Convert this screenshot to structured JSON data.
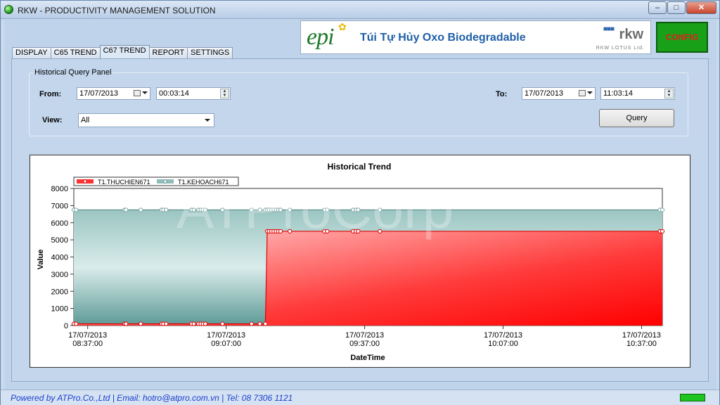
{
  "window": {
    "title": "RKW - PRODUCTIVITY MANAGEMENT SOLUTION"
  },
  "banner": {
    "logo": "epi",
    "text": "Túi Tự Hủy Oxo Biodegradable",
    "brand": "rkw",
    "brand_sub": "RKW LOTUS Ltd."
  },
  "config_button": "CONFIG",
  "tabs": [
    {
      "label": "DISPLAY"
    },
    {
      "label": "C65 TREND"
    },
    {
      "label": "C67 TREND"
    },
    {
      "label": "REPORT"
    },
    {
      "label": "SETTINGS"
    }
  ],
  "active_tab": "C67 TREND",
  "query_panel": {
    "title": "Historical Query Panel",
    "from_label": "From:",
    "from_date": "17/07/2013",
    "from_time": "00:03:14",
    "to_label": "To:",
    "to_date": "17/07/2013",
    "to_time": "11:03:14",
    "view_label": "View:",
    "view_value": "All",
    "query_button": "Query"
  },
  "watermark": "ATProCorp",
  "status": {
    "text": "Powered by ATPro.Co.,Ltd | Email: hotro@atpro.com.vn | Tel: 08 7306 1121"
  },
  "chart_data": {
    "type": "area",
    "title": "Historical Trend",
    "xlabel": "DateTime",
    "ylabel": "Value",
    "ylim": [
      0,
      8000
    ],
    "yticks": [
      0,
      1000,
      2000,
      3000,
      4000,
      5000,
      6000,
      7000,
      8000
    ],
    "xticks": [
      "17/07/2013\n08:37:00",
      "17/07/2013\n09:07:00",
      "17/07/2013\n09:37:00",
      "17/07/2013\n10:07:00",
      "17/07/2013\n10:37:00"
    ],
    "xtick_minutes": [
      0,
      30,
      60,
      90,
      120
    ],
    "xlim_minutes": [
      -3,
      124.5
    ],
    "legend": "top-left",
    "grid": false,
    "series": [
      {
        "name": "T1.THUCHIEN671",
        "color": "#ff0000",
        "points_minutes": [
          -3,
          -2.5,
          8,
          8.3,
          11.5,
          16,
          16.4,
          17,
          22.5,
          23,
          24,
          24.5,
          25,
          25.5,
          29.2,
          35.5,
          37.3,
          38.5,
          38.9,
          39.3,
          39.8,
          40.3,
          40.8,
          41.3,
          41.8,
          43.8,
          51.3,
          51.9,
          57.5,
          58.1,
          58.6,
          63.3,
          124,
          124.5
        ],
        "values": [
          100,
          100,
          100,
          100,
          100,
          100,
          100,
          100,
          100,
          100,
          100,
          100,
          100,
          100,
          100,
          100,
          100,
          100,
          5500,
          5500,
          5500,
          5500,
          5500,
          5500,
          5500,
          5500,
          5500,
          5500,
          5500,
          5500,
          5500,
          5500,
          5500,
          5500
        ]
      },
      {
        "name": "T1.KEHOACH671",
        "color": "#7fb3b0",
        "points_minutes": [
          -3,
          -2.5,
          8,
          8.3,
          11.5,
          16,
          16.4,
          17,
          22.5,
          23,
          24,
          24.5,
          25,
          25.5,
          29.2,
          35.5,
          37.3,
          38.5,
          38.9,
          39.3,
          39.8,
          40.3,
          40.8,
          41.3,
          41.8,
          43.8,
          51.3,
          51.9,
          57.5,
          58.1,
          58.6,
          63.3,
          124,
          124.5
        ],
        "values": [
          6750,
          6750,
          6750,
          6750,
          6750,
          6750,
          6750,
          6750,
          6750,
          6750,
          6750,
          6750,
          6750,
          6750,
          6750,
          6750,
          6750,
          6750,
          6750,
          6750,
          6750,
          6750,
          6750,
          6750,
          6750,
          6750,
          6750,
          6750,
          6750,
          6750,
          6750,
          6750,
          6750,
          6750
        ]
      }
    ]
  }
}
